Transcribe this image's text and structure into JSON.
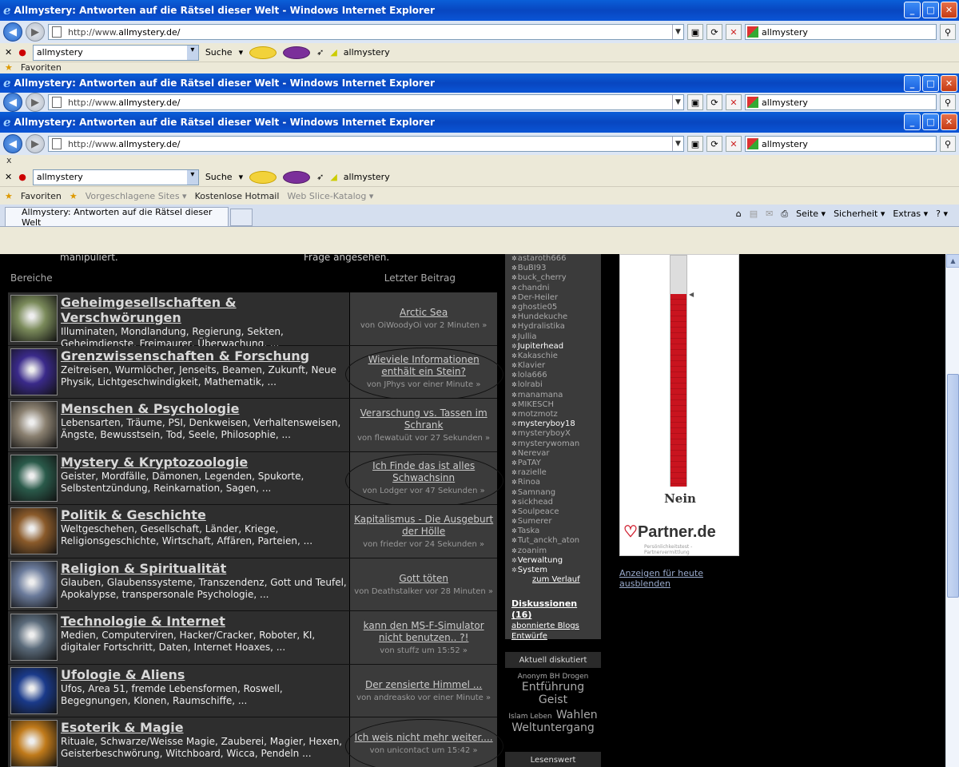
{
  "window": {
    "title": "Allmystery: Antworten auf die Rätsel dieser Welt - Windows Internet Explorer",
    "url_prefix": "http://www.",
    "url_host": "allmystery.de/",
    "search_value": "allmystery",
    "toolbar_input": "allmystery",
    "toolbar_search": "Suche",
    "toolbar_brand": "allmystery",
    "mini": "x"
  },
  "favorites": {
    "label": "Favoriten",
    "items": [
      "Vorgeschlagene Sites ▾",
      "Kostenlose Hotmail",
      "Web Slice-Katalog ▾"
    ]
  },
  "tab": {
    "label": "Allmystery: Antworten auf die Rätsel dieser Welt"
  },
  "commands": [
    "Seite ▾",
    "Sicherheit ▾",
    "Extras ▾",
    "? ▾"
  ],
  "page": {
    "top_left": "manipuliert.",
    "top_right": "Frage angesehen.",
    "section": "Bereiche",
    "last_post": "Letzter Beitrag",
    "categories": [
      {
        "title": "Geheimgesellschaften & Verschwörungen",
        "desc": "Illuminaten, Mondlandung, Regierung, Sekten, Geheimdienste, Freimaurer, Überwachung, ...",
        "last": "Arctic Sea",
        "by": "von OiWoodyOi vor 2 Minuten »",
        "color": "#7a8a5a"
      },
      {
        "title": "Grenzwissenschaften & Forschung",
        "desc": "Zeitreisen, Wurmlöcher, Jenseits, Beamen, Zukunft, Neue Physik, Lichtgeschwindigkeit, Mathematik, ...",
        "last": "Wieviele Informationen enthält ein Stein?",
        "by": "von JPhys vor einer Minute »",
        "color": "#3a2a8a"
      },
      {
        "title": "Menschen & Psychologie",
        "desc": "Lebensarten, Träume, PSI, Denkweisen, Verhaltensweisen, Ängste, Bewusstsein, Tod, Seele, Philosophie, ...",
        "last": "Verarschung vs. Tassen im Schrank",
        "by": "von flewatuüt vor 27 Sekunden »",
        "color": "#8a8070"
      },
      {
        "title": "Mystery & Kryptozoologie",
        "desc": "Geister, Mordfälle, Dämonen, Legenden, Spukorte, Selbstentzündung, Reinkarnation, Sagen, ...",
        "last": "Ich Finde das ist alles Schwachsinn",
        "by": "von Lodger vor 47 Sekunden »",
        "color": "#2a5a4a"
      },
      {
        "title": "Politik & Geschichte",
        "desc": "Weltgeschehen, Gesellschaft, Länder, Kriege, Religionsgeschichte, Wirtschaft, Affären, Parteien, ...",
        "last": "Kapitalismus - Die Ausgeburt der Hölle",
        "by": "von frieder vor 24 Sekunden »",
        "color": "#8a5a2a"
      },
      {
        "title": "Religion & Spiritualität",
        "desc": "Glauben, Glaubenssysteme, Transzendenz, Gott und Teufel, Apokalypse, transpersonale Psychologie, ...",
        "last": "Gott töten",
        "by": "von Deathstalker vor 28 Minuten »",
        "color": "#6a7a9a"
      },
      {
        "title": "Technologie & Internet",
        "desc": "Medien, Computerviren, Hacker/Cracker, Roboter, KI, digitaler Fortschritt, Daten, Internet Hoaxes, ...",
        "last": "kann den MS-F-Simulator nicht benutzen.. ?!",
        "by": "von stuffz um 15:52 »",
        "color": "#5a6a7a"
      },
      {
        "title": "Ufologie & Aliens",
        "desc": "Ufos, Area 51, fremde Lebensformen, Roswell, Begegnungen, Klonen, Raumschiffe, ...",
        "last": "Der zensierte Himmel ...",
        "by": "von andreasko vor einer Minute »",
        "color": "#1a3a8a"
      },
      {
        "title": "Esoterik & Magie",
        "desc": "Rituale, Schwarze/Weisse Magie, Zauberei, Magier, Hexen, Geisterbeschwörung, Witchboard, Wicca, Pendeln ...",
        "last": "Ich weis nicht mehr weiter....",
        "by": "von unicontact um 15:42 »",
        "color": "#c07a1a"
      }
    ]
  },
  "online": {
    "users": [
      "astaroth666",
      "BuBI93",
      "buck_cherry",
      "chandni",
      "Der-Heiler",
      "ghostie05",
      "Hundekuche",
      "Hydralistika",
      "Jullia",
      "Jupiterhead",
      "Kakaschie",
      "Klavier",
      "lola666",
      "lolrabi",
      "manamana",
      "MIKESCH",
      "motzmotz",
      "mysteryboy18",
      "mysteryboyX",
      "mysterywoman",
      "Nerevar",
      "PaTAY",
      "razielle",
      "Rinoa",
      "Samnang",
      "sickhead",
      "Soulpeace",
      "Sumerer",
      "Taska",
      "Tut_anckh_aton",
      "zoanim",
      "Verwaltung",
      "System"
    ],
    "history_link": "zum Verlauf",
    "discussions": "Diskussionen (16)",
    "blogs": "abonnierte Blogs",
    "drafts": "Entwürfe"
  },
  "discussed": {
    "header": "Aktuell diskutiert",
    "tags_small": "Anonym BH Drogen",
    "tags_large": "Entführung Geist",
    "tags_mid": "Islam Leben",
    "tags_large2": "Wahlen",
    "tags_large3": "Weltuntergang"
  },
  "worth_reading": {
    "header": "Lesenswert"
  },
  "ad": {
    "poll_label": "Nein",
    "poll_level_pct": 83,
    "brand": "Partner.de",
    "brand_sub": "Persönlichkeitstest - Partnervermittlung",
    "hide_link": "Anzeigen für heute ausblenden"
  },
  "colors": {
    "xp_blue": "#0a55d6",
    "page_bg": "#000000",
    "thermo_red": "#c9141f"
  }
}
